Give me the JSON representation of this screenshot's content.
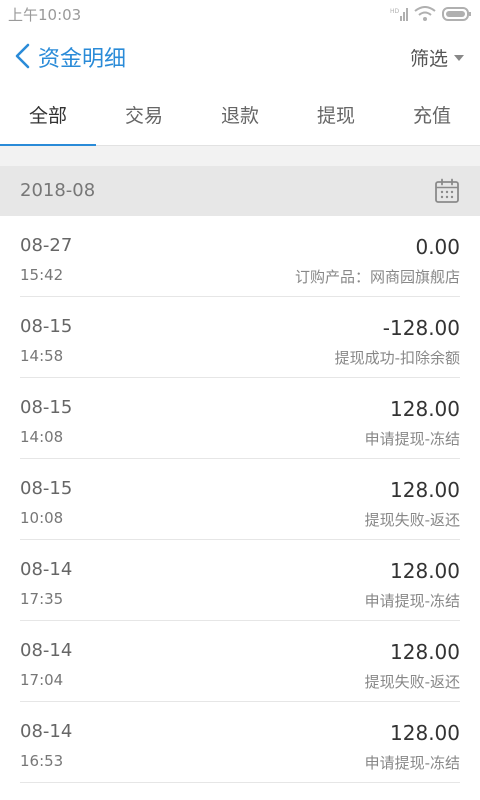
{
  "status_bar": {
    "time": "上午10:03",
    "icons": [
      "hd-signal-icon",
      "wifi-icon",
      "battery-icon"
    ]
  },
  "nav": {
    "title": "资金明细",
    "filter_label": "筛选",
    "accent_color": "#2a8bd8"
  },
  "tabs": [
    {
      "label": "全部",
      "active": true
    },
    {
      "label": "交易",
      "active": false
    },
    {
      "label": "退款",
      "active": false
    },
    {
      "label": "提现",
      "active": false
    },
    {
      "label": "充值",
      "active": false
    }
  ],
  "month": {
    "label": "2018-08",
    "icon": "calendar-icon"
  },
  "records": [
    {
      "date": "08-27",
      "time": "15:42",
      "amount": "0.00",
      "desc": "订购产品：网商园旗舰店"
    },
    {
      "date": "08-15",
      "time": "14:58",
      "amount": "-128.00",
      "desc": "提现成功-扣除余额"
    },
    {
      "date": "08-15",
      "time": "14:08",
      "amount": "128.00",
      "desc": "申请提现-冻结"
    },
    {
      "date": "08-15",
      "time": "10:08",
      "amount": "128.00",
      "desc": "提现失败-返还"
    },
    {
      "date": "08-14",
      "time": "17:35",
      "amount": "128.00",
      "desc": "申请提现-冻结"
    },
    {
      "date": "08-14",
      "time": "17:04",
      "amount": "128.00",
      "desc": "提现失败-返还"
    },
    {
      "date": "08-14",
      "time": "16:53",
      "amount": "128.00",
      "desc": "申请提现-冻结"
    }
  ]
}
